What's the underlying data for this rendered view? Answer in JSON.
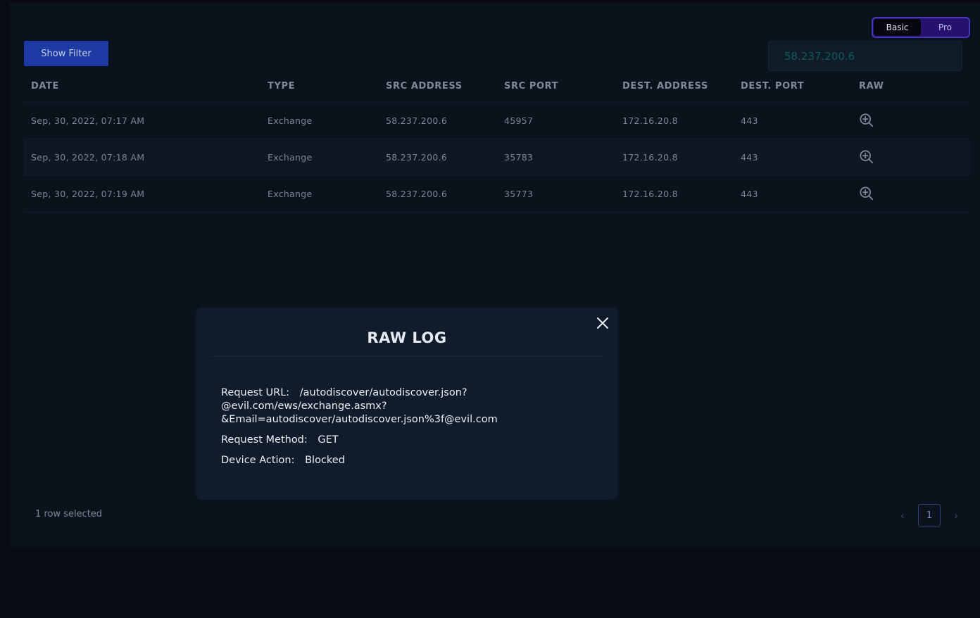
{
  "mode_toggle": {
    "basic_label": "Basic",
    "pro_label": "Pro",
    "active": "Basic"
  },
  "filter": {
    "button_label": "Show Filter"
  },
  "search": {
    "value": "58.237.200.6"
  },
  "table": {
    "columns": [
      "DATE",
      "TYPE",
      "SRC ADDRESS",
      "SRC PORT",
      "DEST. ADDRESS",
      "DEST. PORT",
      "RAW"
    ],
    "rows": [
      {
        "date": "Sep, 30, 2022, 07:17 AM",
        "type": "Exchange",
        "src_address": "58.237.200.6",
        "src_port": "45957",
        "dest_address": "172.16.20.8",
        "dest_port": "443",
        "raw_icon": "zoom-in-icon"
      },
      {
        "date": "Sep, 30, 2022, 07:18 AM",
        "type": "Exchange",
        "src_address": "58.237.200.6",
        "src_port": "35783",
        "dest_address": "172.16.20.8",
        "dest_port": "443",
        "raw_icon": "zoom-in-icon"
      },
      {
        "date": "Sep, 30, 2022, 07:19 AM",
        "type": "Exchange",
        "src_address": "58.237.200.6",
        "src_port": "35773",
        "dest_address": "172.16.20.8",
        "dest_port": "443",
        "raw_icon": "zoom-in-icon"
      }
    ]
  },
  "footer": {
    "status": "1 row selected"
  },
  "pagination": {
    "current_page": "1",
    "prev_icon": "chevron-left-icon",
    "next_icon": "chevron-right-icon"
  },
  "modal": {
    "title": "RAW LOG",
    "close_icon": "close-icon",
    "request_url_label": "Request URL:",
    "request_url_lines": [
      "/autodiscover/autodiscover.json?",
      "@evil.com/ews/exchange.asmx?",
      "&Email=autodiscover/autodiscover.json%3f@evil.com"
    ],
    "request_method_label": "Request Method:",
    "request_method": "GET",
    "device_action_label": "Device Action:",
    "device_action": "Blocked"
  },
  "colors": {
    "background": "#080a16",
    "panel": "#0a121c",
    "modal": "#101b2b",
    "accent_button": "#1c3aa2",
    "toggle_pro": "#24126e"
  }
}
